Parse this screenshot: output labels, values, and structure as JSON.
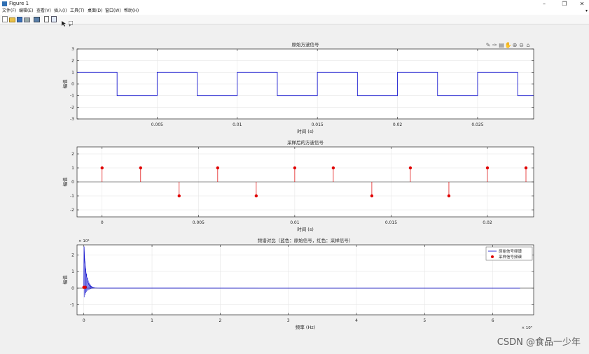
{
  "window": {
    "title": "Figure 1",
    "controls": [
      "–",
      "❐",
      "✕"
    ]
  },
  "menu": {
    "items": [
      "文件(F)",
      "编辑(E)",
      "查看(V)",
      "插入(I)",
      "工具(T)",
      "桌面(D)",
      "窗口(W)",
      "帮助(H)"
    ],
    "overflow": "▾"
  },
  "toolbar": {
    "icons": [
      "new-figure-icon",
      "open-icon",
      "save-icon",
      "print-icon",
      "link-icon",
      "hide-plot-tools-icon",
      "show-plot-tools-icon",
      "edit-plot-icon",
      "data-cursor-icon"
    ]
  },
  "axes_toolbar": {
    "icons": [
      "brush-icon",
      "data-tip-icon",
      "export-icon",
      "pan-icon",
      "zoom-in-icon",
      "zoom-out-icon",
      "home-icon"
    ]
  },
  "watermark": "CSDN @食品一少年",
  "colors": {
    "blue": "#1f1fd0",
    "red": "#e00000",
    "grid": "#e6e6e6"
  },
  "chart_data": [
    {
      "type": "line",
      "title": "原始方波信号",
      "xlabel": "时间 (s)",
      "ylabel": "幅值",
      "xlim": [
        0,
        0.0285
      ],
      "ylim": [
        -3,
        3
      ],
      "xticks": [
        0.005,
        0.01,
        0.015,
        0.02,
        0.025
      ],
      "xtick_labels": [
        "0.005",
        "0.01",
        "0.015",
        "0.02",
        "0.025"
      ],
      "yticks": [
        -3,
        -2,
        -1,
        0,
        1,
        2,
        3
      ],
      "ytick_labels": [
        "-3",
        "-2",
        "-1",
        "0",
        "1",
        "2",
        "3"
      ],
      "grid": true,
      "series": [
        {
          "color": "#1f1fd0",
          "period": 0.005,
          "duty": 0.5,
          "high": 1,
          "low": -1
        }
      ]
    },
    {
      "type": "stem",
      "title": "采样后的方波信号",
      "xlabel": "时间 (s)",
      "ylabel": "幅值",
      "xlim": [
        -0.0013,
        0.0224
      ],
      "ylim": [
        -2.5,
        2.5
      ],
      "xticks": [
        0,
        0.005,
        0.01,
        0.015,
        0.02
      ],
      "xtick_labels": [
        "0",
        "0.005",
        "0.01",
        "0.015",
        "0.02"
      ],
      "yticks": [
        -2,
        -1,
        0,
        1,
        2
      ],
      "ytick_labels": [
        "-2",
        "-1",
        "0",
        "1",
        "2"
      ],
      "grid": true,
      "series": [
        {
          "color": "#e00000",
          "x": [
            0,
            0.002,
            0.004,
            0.006,
            0.008,
            0.01,
            0.012,
            0.014,
            0.016,
            0.018,
            0.02,
            0.022
          ],
          "y": [
            1,
            1,
            -1,
            1,
            -1,
            1,
            1,
            -1,
            1,
            -1,
            1,
            1
          ]
        }
      ]
    },
    {
      "type": "line",
      "title": "频谱对比（蓝色：原始信号，红色：采样信号）",
      "xlabel": "频率 (Hz)",
      "ylabel": "幅值",
      "xlim": [
        -0.1,
        6.6
      ],
      "ylim": [
        -1.6,
        2.6
      ],
      "x_exponent": "× 10⁵",
      "y_exponent": "× 10⁴",
      "xticks": [
        0,
        1,
        2,
        3,
        4,
        5,
        6
      ],
      "xtick_labels": [
        "0",
        "1",
        "2",
        "3",
        "4",
        "5",
        "6"
      ],
      "yticks": [
        -1,
        0,
        1,
        2
      ],
      "ytick_labels": [
        "-1",
        "0",
        "1",
        "2"
      ],
      "grid": true,
      "legend": {
        "position": "top-right",
        "entries": [
          "原始信号频谱",
          "采样信号频谱"
        ]
      },
      "series": [
        {
          "name": "原始信号频谱",
          "color": "#1f1fd0",
          "peak_x": 0.003,
          "peak_y": 2.5,
          "extent_x": 6.4
        },
        {
          "name": "采样信号频谱",
          "color": "#e00000",
          "x": [
            0.0,
            0.02
          ],
          "y": [
            0.05,
            0.05
          ]
        }
      ]
    }
  ]
}
